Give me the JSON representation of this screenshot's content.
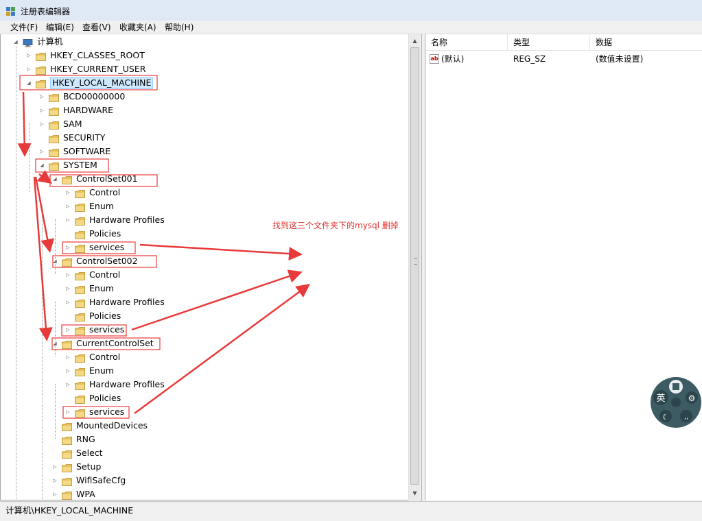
{
  "window": {
    "title": "注册表编辑器"
  },
  "menu": [
    "文件(F)",
    "编辑(E)",
    "查看(V)",
    "收藏夹(A)",
    "帮助(H)"
  ],
  "tree": [
    {
      "label": "计算机",
      "level": 0,
      "expander": "open",
      "icon": "computer-icon"
    },
    {
      "label": "HKEY_CLASSES_ROOT",
      "level": 1,
      "expander": "closed",
      "icon": "folder-icon"
    },
    {
      "label": "HKEY_CURRENT_USER",
      "level": 1,
      "expander": "closed",
      "icon": "folder-icon"
    },
    {
      "label": "HKEY_LOCAL_MACHINE",
      "level": 1,
      "expander": "open",
      "icon": "folder-icon",
      "selected": true
    },
    {
      "label": "BCD00000000",
      "level": 2,
      "expander": "closed",
      "icon": "folder-icon"
    },
    {
      "label": "HARDWARE",
      "level": 2,
      "expander": "closed",
      "icon": "folder-icon"
    },
    {
      "label": "SAM",
      "level": 2,
      "expander": "closed",
      "icon": "folder-icon"
    },
    {
      "label": "SECURITY",
      "level": 2,
      "expander": "none",
      "icon": "folder-icon"
    },
    {
      "label": "SOFTWARE",
      "level": 2,
      "expander": "closed",
      "icon": "folder-icon"
    },
    {
      "label": "SYSTEM",
      "level": 2,
      "expander": "open",
      "icon": "folder-icon"
    },
    {
      "label": "ControlSet001",
      "level": 3,
      "expander": "open",
      "icon": "folder-icon"
    },
    {
      "label": "Control",
      "level": 4,
      "expander": "closed",
      "icon": "folder-icon"
    },
    {
      "label": "Enum",
      "level": 4,
      "expander": "closed",
      "icon": "folder-icon"
    },
    {
      "label": "Hardware Profiles",
      "level": 4,
      "expander": "closed",
      "icon": "folder-icon"
    },
    {
      "label": "Policies",
      "level": 4,
      "expander": "none",
      "icon": "folder-icon"
    },
    {
      "label": "services",
      "level": 4,
      "expander": "closed",
      "icon": "folder-icon"
    },
    {
      "label": "ControlSet002",
      "level": 3,
      "expander": "open",
      "icon": "folder-icon"
    },
    {
      "label": "Control",
      "level": 4,
      "expander": "closed",
      "icon": "folder-icon"
    },
    {
      "label": "Enum",
      "level": 4,
      "expander": "closed",
      "icon": "folder-icon"
    },
    {
      "label": "Hardware Profiles",
      "level": 4,
      "expander": "closed",
      "icon": "folder-icon"
    },
    {
      "label": "Policies",
      "level": 4,
      "expander": "none",
      "icon": "folder-icon"
    },
    {
      "label": "services",
      "level": 4,
      "expander": "closed",
      "icon": "folder-icon"
    },
    {
      "label": "CurrentControlSet",
      "level": 3,
      "expander": "open",
      "icon": "folder-icon"
    },
    {
      "label": "Control",
      "level": 4,
      "expander": "closed",
      "icon": "folder-icon"
    },
    {
      "label": "Enum",
      "level": 4,
      "expander": "closed",
      "icon": "folder-icon"
    },
    {
      "label": "Hardware Profiles",
      "level": 4,
      "expander": "closed",
      "icon": "folder-icon"
    },
    {
      "label": "Policies",
      "level": 4,
      "expander": "none",
      "icon": "folder-icon"
    },
    {
      "label": "services",
      "level": 4,
      "expander": "closed",
      "icon": "folder-icon"
    },
    {
      "label": "MountedDevices",
      "level": 3,
      "expander": "none",
      "icon": "folder-icon"
    },
    {
      "label": "RNG",
      "level": 3,
      "expander": "none",
      "icon": "folder-icon"
    },
    {
      "label": "Select",
      "level": 3,
      "expander": "none",
      "icon": "folder-icon"
    },
    {
      "label": "Setup",
      "level": 3,
      "expander": "closed",
      "icon": "folder-icon"
    },
    {
      "label": "WifiSafeCfg",
      "level": 3,
      "expander": "closed",
      "icon": "folder-icon"
    },
    {
      "label": "WPA",
      "level": 3,
      "expander": "closed",
      "icon": "folder-icon"
    }
  ],
  "list": {
    "columns": [
      "名称",
      "类型",
      "数据"
    ],
    "rows": [
      {
        "name": "(默认)",
        "type": "REG_SZ",
        "data": "(数值未设置)",
        "icon": "string-value-icon"
      }
    ]
  },
  "status": "计算机\\HKEY_LOCAL_MACHINE",
  "annotation": {
    "text": "找到这三个文件夹下的mysql 删掉",
    "color": "#e0312f"
  },
  "ime": {
    "label": "英"
  },
  "colors": {
    "folder": "#e8c15a",
    "selection": "#cde8ff",
    "annotation_red": "#e0312f",
    "ime_bg": "#3d5b63"
  }
}
